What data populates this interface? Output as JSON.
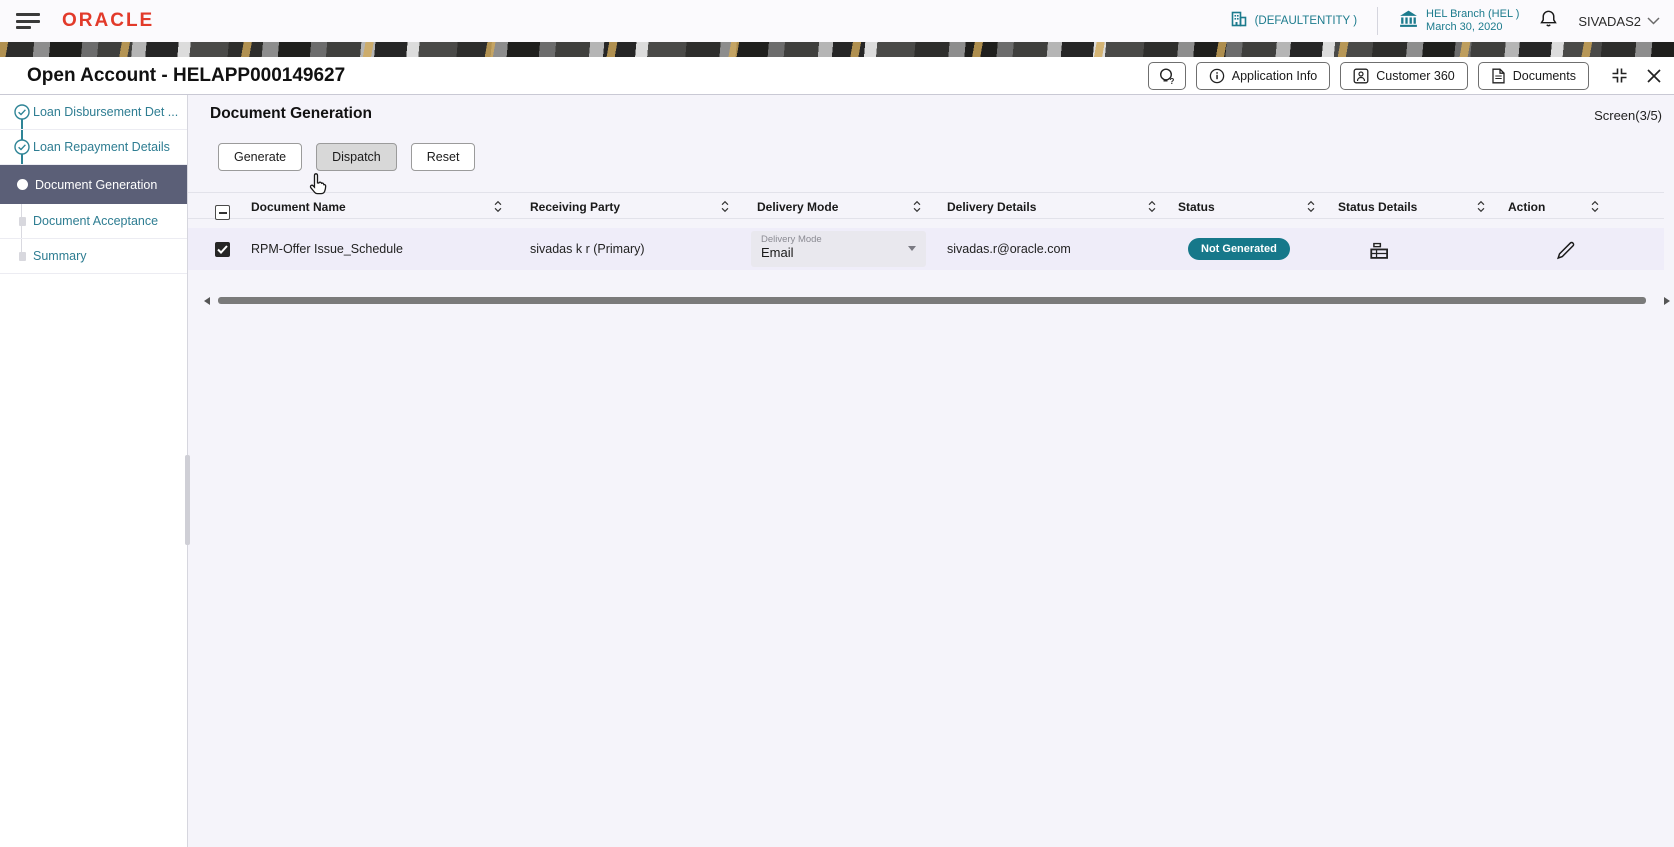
{
  "topbar": {
    "brand": "ORACLE",
    "entity_label": "(DEFAULTENTITY )",
    "branch_name": "HEL Branch (HEL )",
    "branch_date": "March 30, 2020",
    "username": "SIVADAS2"
  },
  "titlebar": {
    "title": "Open Account - HELAPP000149627",
    "buttons": [
      {
        "label": "Application Info"
      },
      {
        "label": "Customer 360"
      },
      {
        "label": "Documents"
      }
    ]
  },
  "sidebar": {
    "items": [
      {
        "label": "Loan Disbursement Det ...",
        "state": "completed"
      },
      {
        "label": "Loan Repayment Details",
        "state": "completed"
      },
      {
        "label": "Document Generation",
        "state": "active"
      },
      {
        "label": "Document Acceptance",
        "state": "pending"
      },
      {
        "label": "Summary",
        "state": "pending"
      }
    ]
  },
  "content": {
    "heading": "Document Generation",
    "screen_indicator": "Screen(3/5)",
    "actions": {
      "generate": "Generate",
      "dispatch": "Dispatch",
      "reset": "Reset"
    },
    "table": {
      "select_all_state": "indeterminate",
      "columns": [
        "Document Name",
        "Receiving Party",
        "Delivery Mode",
        "Delivery Details",
        "Status",
        "Status Details",
        "Action"
      ],
      "rows": [
        {
          "selected": true,
          "document_name": "RPM-Offer Issue_Schedule",
          "receiving_party": "sivadas k r (Primary)",
          "delivery_mode_label": "Delivery Mode",
          "delivery_mode_value": "Email",
          "delivery_details": "sivadas.r@oracle.com",
          "status": "Not Generated"
        }
      ]
    }
  },
  "colors": {
    "oracle_red": "#e23a2a",
    "accent_teal": "#1c7b8d",
    "active_step_bg": "#5b5f77",
    "status_badge_bg": "#16788a",
    "row_bg": "#efedf9"
  }
}
